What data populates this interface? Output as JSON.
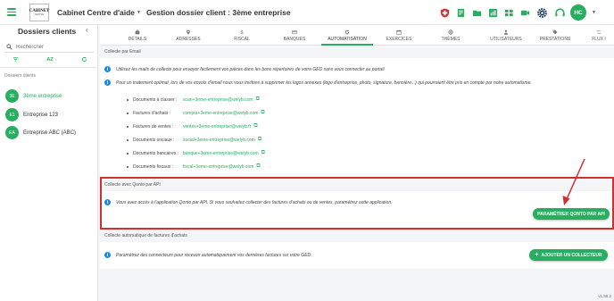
{
  "header": {
    "logo_line1": "CABINET",
    "logo_line2": "CENTRE",
    "cabinet_name": "Cabinet Centre d'aide",
    "page_title": "Gestion dossier client : 3ème entreprise",
    "avatar_initials": "HC"
  },
  "sidebar": {
    "title": "Dossiers clients",
    "search_placeholder": "Rechercher",
    "sort_label": "AZ",
    "section_label": "Dossiers clients",
    "clients": [
      {
        "initials": "3E",
        "name": "3ème entreprise",
        "active": true
      },
      {
        "initials": "E1",
        "name": "Entreprise 123",
        "active": false
      },
      {
        "initials": "EA",
        "name": "Entreprise ABC (ABC)",
        "active": false
      }
    ]
  },
  "tabs": [
    "DÉTAILS",
    "ADRESSES",
    "FISCAL",
    "BANQUES",
    "AUTOMATISATION",
    "EXERCICES",
    "THÈMES",
    "UTILISATEURS",
    "PRESTATIONS",
    "FLUX I"
  ],
  "active_tab": "AUTOMATISATION",
  "email_section": {
    "heading": "Collecte par Email",
    "info1": "Utilisez les mails de collecte pour envoyer facilement vos pièces dans les bons répertoires de votre GED sans vous connecter au portail.",
    "info2": "Pour un traitement optimal, lors de vos envois d'email nous vous invitons à supprimer les logos annexes (logo d'entreprise, photo, signature, bannière...) qui pourraient être pris en compte par notre automatisme.",
    "rows": [
      {
        "label": "Documents à classer :",
        "address": "scan+3eme-entreprise@welyb.com"
      },
      {
        "label": "Factures d'achats :",
        "address": "compta+3eme-entreprise@welyb.com"
      },
      {
        "label": "Factures de ventes :",
        "address": "ventes+3eme-entreprise@welyb.fr"
      },
      {
        "label": "Documents sociaux :",
        "address": "social+3eme-entreprise@welyb.com"
      },
      {
        "label": "Documents bancaires :",
        "address": "banque+3eme-entreprise@welyb.com"
      },
      {
        "label": "Documents fiscaux :",
        "address": "fiscal+3eme-entreprise@welyb.com"
      }
    ]
  },
  "qonto_section": {
    "heading": "Collecte avec Qonto par API",
    "info": "Vous avez accès à l'application Qonto par API. Si vous souhaitez collecter des factures d'achats ou de ventes, paramétrez cette application.",
    "button": "PARAMÉTRER QONTO PAR API"
  },
  "auto_section": {
    "heading": "Collecte automatique de factures d'achats",
    "info": "Paramétrez des connecteurs pour recevoir automatiquement vos dernières factures sur votre GED.",
    "button": "AJOUTER UN COLLECTEUR"
  },
  "version": "v1.58.2",
  "colors": {
    "accent": "#27ae60",
    "highlight_box": "#d32f2f",
    "info_icon": "#1e88e5"
  }
}
